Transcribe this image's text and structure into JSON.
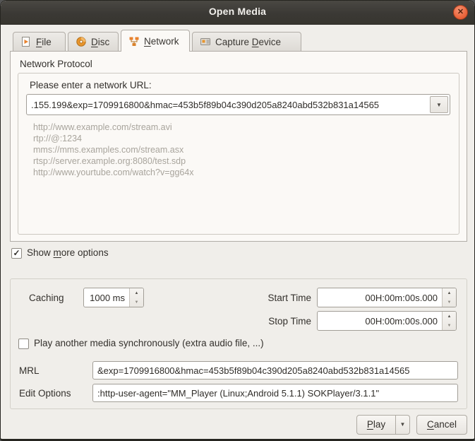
{
  "window": {
    "title": "Open Media",
    "close_glyph": "✕"
  },
  "colors": {
    "accent_orange": "#e95420",
    "titlebar": "#3b3935",
    "dialog_bg": "#f0eeea",
    "pane_bg": "#fbf9f6",
    "close_button": "#ec6a41"
  },
  "tabs": {
    "file": {
      "pre": "",
      "key": "F",
      "post": "ile"
    },
    "disc": {
      "pre": "",
      "key": "D",
      "post": "isc"
    },
    "network": {
      "pre": "",
      "key": "N",
      "post": "etwork"
    },
    "capture": {
      "pre": "Capture ",
      "key": "D",
      "post": "evice"
    }
  },
  "network_tab": {
    "group_title": "Network Protocol",
    "url_label": "Please enter a network URL:",
    "url_value": ".155.199&exp=1709916800&hmac=453b5f89b04c390d205a8240abd532b831a14565",
    "examples": "http://www.example.com/stream.avi\nrtp://@:1234\nmms://mms.examples.com/stream.asx\nrtsp://server.example.org:8080/test.sdp\nhttp://www.yourtube.com/watch?v=gg64x"
  },
  "show_more": {
    "pre": "Show ",
    "key": "m",
    "post": "ore options",
    "checked": true,
    "checkmark": "✓"
  },
  "options": {
    "caching_label": "Caching",
    "caching_value": "1000 ms",
    "start_time_label": "Start Time",
    "start_time_value": "00H:00m:00s.000",
    "stop_time_label": "Stop Time",
    "stop_time_value": "00H:00m:00s.000",
    "sync_label": "Play another media synchronously (extra audio file, ...)",
    "sync_checked": false,
    "mrl_label": "MRL",
    "mrl_value": "&exp=1709916800&hmac=453b5f89b04c390d205a8240abd532b831a14565",
    "edit_label": "Edit Options",
    "edit_value": ":http-user-agent=\"MM_Player (Linux;Android 5.1.1) SOKPlayer/3.1.1\""
  },
  "buttons": {
    "play": {
      "pre": "",
      "key": "P",
      "post": "lay"
    },
    "cancel": {
      "pre": "",
      "key": "C",
      "post": "ancel"
    }
  },
  "glyphs": {
    "combo_arrow": "▼",
    "spin_up": "▲",
    "spin_down": "▼"
  }
}
